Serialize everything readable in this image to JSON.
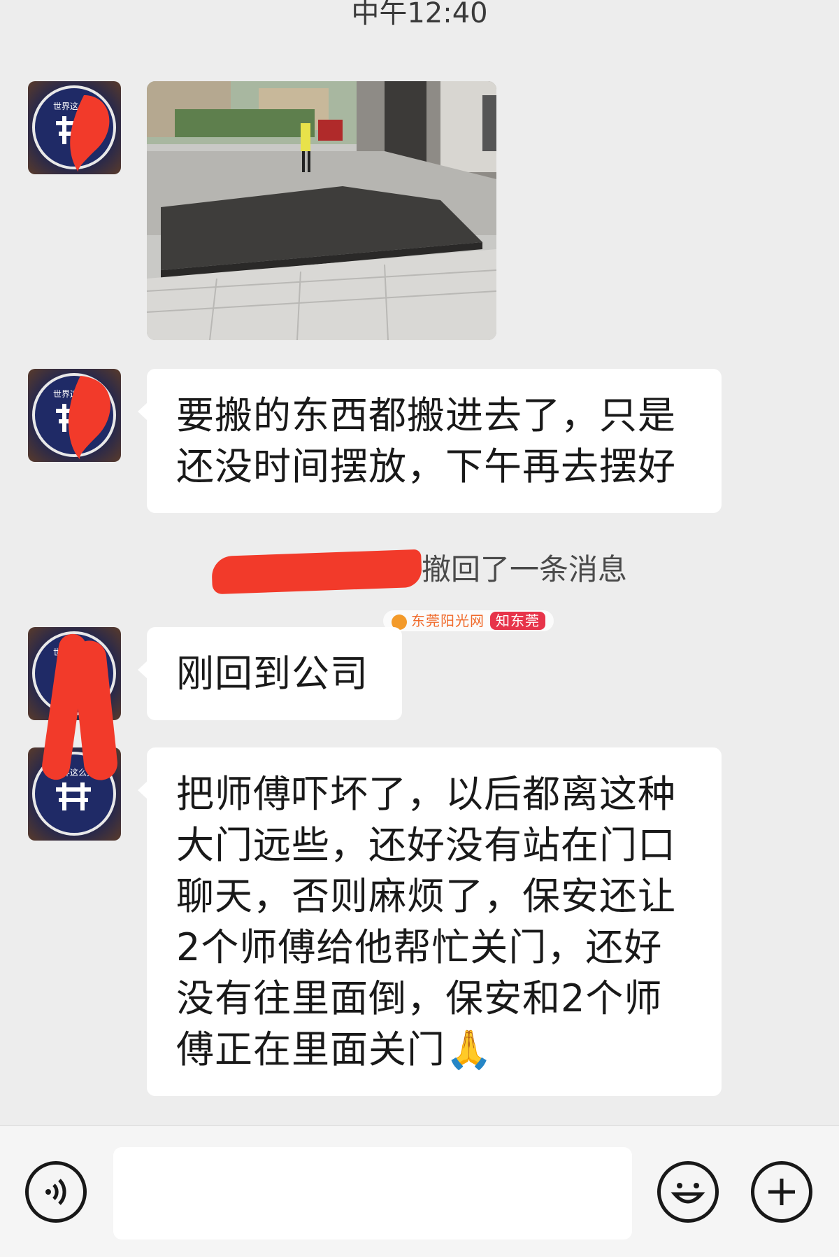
{
  "header": {
    "timestamp": "中午12:40"
  },
  "messages": [
    {
      "type": "image",
      "avatar_icon": "store-logo-avatar",
      "image_icon": "storefront-photo"
    },
    {
      "type": "text",
      "lines": [
        "要搬的东西都搬进去了，只是",
        "还没时间摆放，下午再去摆好"
      ]
    },
    {
      "type": "system",
      "text": "撤回了一条消息"
    },
    {
      "type": "text",
      "lines": [
        "刚回到公司"
      ]
    },
    {
      "type": "text",
      "lines": [
        "把师傅吓坏了，以后都离这种",
        "大门远些，还好没有站在门口",
        "聊天，否则麻烦了，保安还让",
        "2个师傅给他帮忙关门，还好",
        "没有往里面倒，保安和2个师",
        "傅正在里面关门🙏"
      ]
    }
  ],
  "watermark": {
    "left": "东莞阳光网",
    "right": "知东莞"
  },
  "input_bar": {
    "voice_icon": "voice-icon",
    "emoji_icon": "emoji-icon",
    "plus_icon": "plus-icon",
    "placeholder": ""
  },
  "colors": {
    "background": "#ededed",
    "bubble": "#ffffff",
    "redaction": "#f23a2a"
  }
}
